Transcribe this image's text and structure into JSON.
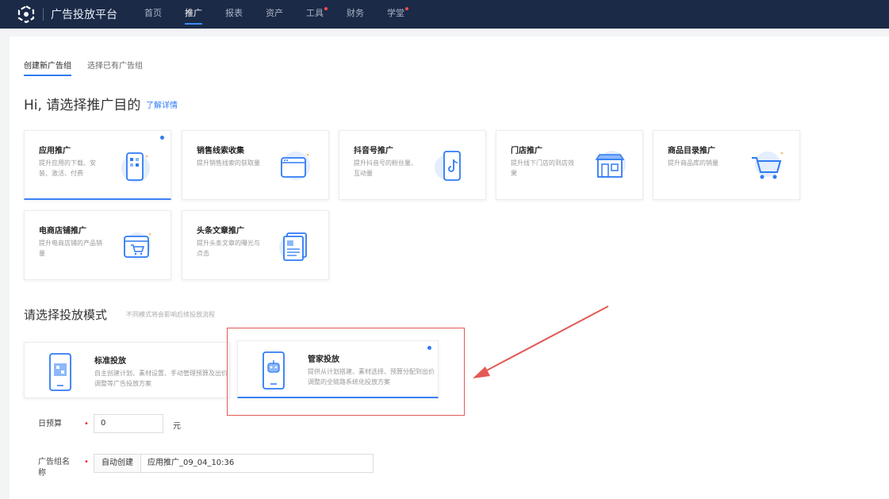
{
  "brand": {
    "title": "广告投放平台"
  },
  "nav": [
    {
      "label": "首页",
      "active": false,
      "dot": false
    },
    {
      "label": "推广",
      "active": true,
      "dot": false
    },
    {
      "label": "报表",
      "active": false,
      "dot": false
    },
    {
      "label": "资产",
      "active": false,
      "dot": false
    },
    {
      "label": "工具",
      "active": false,
      "dot": true
    },
    {
      "label": "财务",
      "active": false,
      "dot": false
    },
    {
      "label": "学堂",
      "active": false,
      "dot": true
    }
  ],
  "tabs": {
    "create": "创建新广告组",
    "select": "选择已有广告组"
  },
  "purpose": {
    "title": "Hi, 请选择推广目的",
    "link": "了解详情",
    "cards": [
      {
        "title": "应用推广",
        "desc": "提升应用的下载、安装、激活、付费",
        "icon": "phone-app-icon",
        "selected": true
      },
      {
        "title": "销售线索收集",
        "desc": "提升销售线索的获取量",
        "icon": "browser-window-icon",
        "selected": false
      },
      {
        "title": "抖音号推广",
        "desc": "提升抖音号的粉丝量、互动量",
        "icon": "douyin-phone-icon",
        "selected": false
      },
      {
        "title": "门店推广",
        "desc": "提升线下门店的到店效果",
        "icon": "storefront-icon",
        "selected": false
      },
      {
        "title": "商品目录推广",
        "desc": "提升商品库的销量",
        "icon": "shopping-cart-icon",
        "selected": false
      },
      {
        "title": "电商店铺推广",
        "desc": "提升电商店铺的产品销量",
        "icon": "shop-cart-window-icon",
        "selected": false
      },
      {
        "title": "头条文章推广",
        "desc": "提升头条文章的曝光与点击",
        "icon": "article-document-icon",
        "selected": false
      }
    ]
  },
  "mode": {
    "title": "请选择投放模式",
    "subtitle": "不同模式将会影响后续投放流程",
    "options": [
      {
        "title": "标准投放",
        "desc": "自主创建计划、素材设置、手动管理预算及出价调整等广告投放方案",
        "icon": "phone-qr-icon",
        "selected": false
      },
      {
        "title": "管家投放",
        "desc": "提供从计划搭建、素材选择、预算分配到出价调整的全链路系统化投放方案",
        "icon": "phone-robot-icon",
        "selected": true
      }
    ]
  },
  "form": {
    "budget_label": "日预算",
    "budget_value": "0",
    "budget_unit": "元",
    "name_label": "广告组名称",
    "name_addon": "自动创建",
    "name_value": "应用推广_09_04_10:36"
  },
  "colors": {
    "nav_bg": "#1b2a47",
    "accent": "#2f7bf5",
    "highlight": "#e35a55"
  }
}
